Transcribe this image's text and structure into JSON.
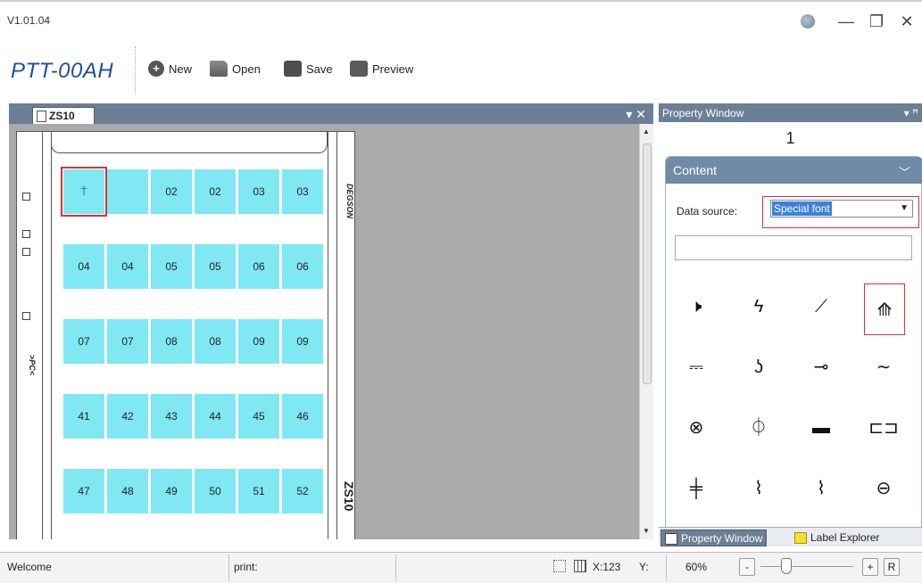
{
  "window": {
    "version": "V1.01.04",
    "globe_icon": "globe-icon",
    "minimize_glyph": "—",
    "restore_glyph": "❐",
    "close_glyph": "✕"
  },
  "toolbar": {
    "brand": "PTT-00AH",
    "new_label": "New",
    "open_label": "Open",
    "save_label": "Save",
    "preview_label": "Preview"
  },
  "document": {
    "tab_label": "ZS10",
    "tab_controls": "▾ ✕",
    "rows": [
      [
        "⍑",
        "",
        "02",
        "02",
        "03",
        "03"
      ],
      [
        "04",
        "04",
        "05",
        "05",
        "06",
        "06"
      ],
      [
        "07",
        "07",
        "08",
        "08",
        "09",
        "09"
      ],
      [
        "41",
        "42",
        "43",
        "44",
        "45",
        "46"
      ],
      [
        "47",
        "48",
        "49",
        "50",
        "51",
        "52"
      ]
    ],
    "side_text_left": ">PC<",
    "side_text_brand": "DEGSON",
    "side_text_model": "ZS10"
  },
  "property": {
    "header": "Property Window",
    "pin": "▾ ꟸ",
    "number": "1",
    "content_title": "Content",
    "content_chevron": "﹀",
    "data_source_label": "Data source:",
    "data_source_value": "Special font",
    "symbols": [
      [
        "🕨",
        "ϟ",
        "⟋",
        "⟰"
      ],
      [
        "⎓",
        "ʖ",
        "⊸",
        "∼"
      ],
      [
        "⊗",
        "⏀",
        "▬",
        "⊏⊐"
      ],
      [
        "╪",
        "⌇",
        "⌇",
        "⊖"
      ]
    ],
    "tab1_label": "Property Window",
    "tab2_label": "Label Explorer"
  },
  "status": {
    "welcome": "Welcome",
    "print": "print:",
    "x": "X:123",
    "y": "Y:",
    "zoom": "60%",
    "zoom_minus": "-",
    "zoom_plus": "+",
    "zoom_reset": "R",
    "zoom_level": 0.25
  }
}
